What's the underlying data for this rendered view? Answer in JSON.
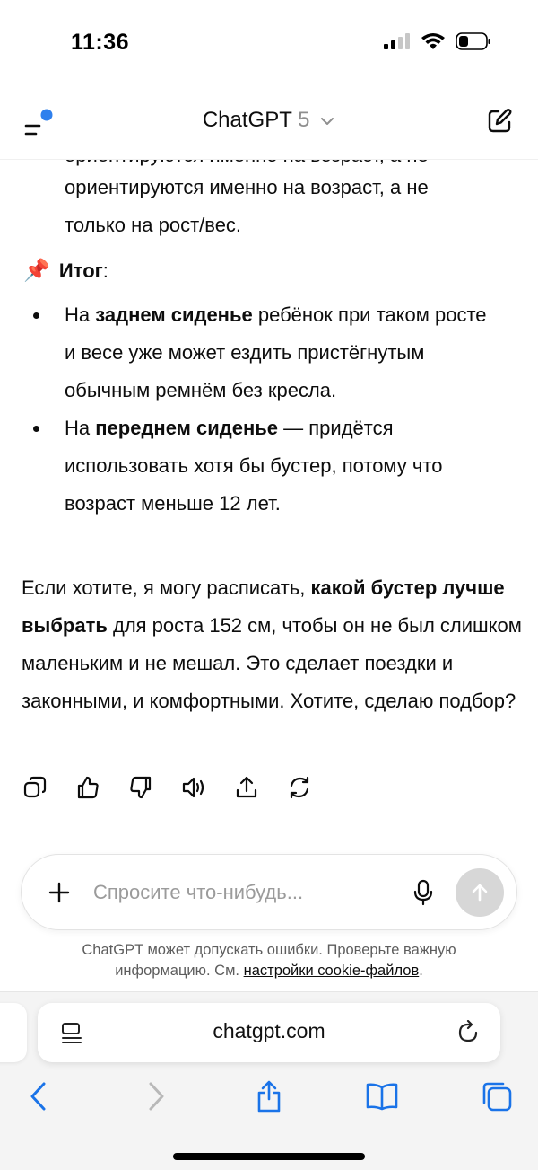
{
  "status_bar": {
    "time": "11:36"
  },
  "header": {
    "app_name": "ChatGPT",
    "model_version": "5"
  },
  "message": {
    "clipped_line": "ориентируются именно на возраст, а не",
    "line1": "ориентируются именно на возраст, а не",
    "line2": "только на рост/вес.",
    "summary_emoji": "📌",
    "summary_label": "Итог",
    "summary_colon": ":",
    "bullet1": {
      "prefix": "На ",
      "bold": "заднем сиденье",
      "rest": " ребёнок при таком росте и весе уже может ездить пристёгнутым обычным ремнём без кресла."
    },
    "bullet2": {
      "prefix": "На ",
      "bold": "переднем сиденье",
      "rest": " — придётся использовать хотя бы бустер, потому что возраст меньше 12 лет."
    },
    "paragraph": {
      "prefix": "Если хотите, я могу расписать, ",
      "bold": "какой бустер лучше выбрать",
      "rest": " для роста 152 см, чтобы он не был слишком маленьким и не мешал. Это сделает поездки и законными, и комфортными. Хотите, сделаю подбор?"
    }
  },
  "message_actions": [
    "copy-icon",
    "thumbs-up-icon",
    "thumbs-down-icon",
    "read-aloud-icon",
    "share-icon",
    "regenerate-icon"
  ],
  "composer": {
    "placeholder": "Спросите что-нибудь..."
  },
  "disclaimer": {
    "text": "ChatGPT может допускать ошибки. Проверьте важную информацию. См. ",
    "link": "настройки cookie-файлов",
    "end": "."
  },
  "browser": {
    "url": "chatgpt.com"
  },
  "colors": {
    "accent_dot": "#2f80ed",
    "send_button_disabled": "#d7d7d7",
    "safari_blue": "#1a73e8"
  }
}
